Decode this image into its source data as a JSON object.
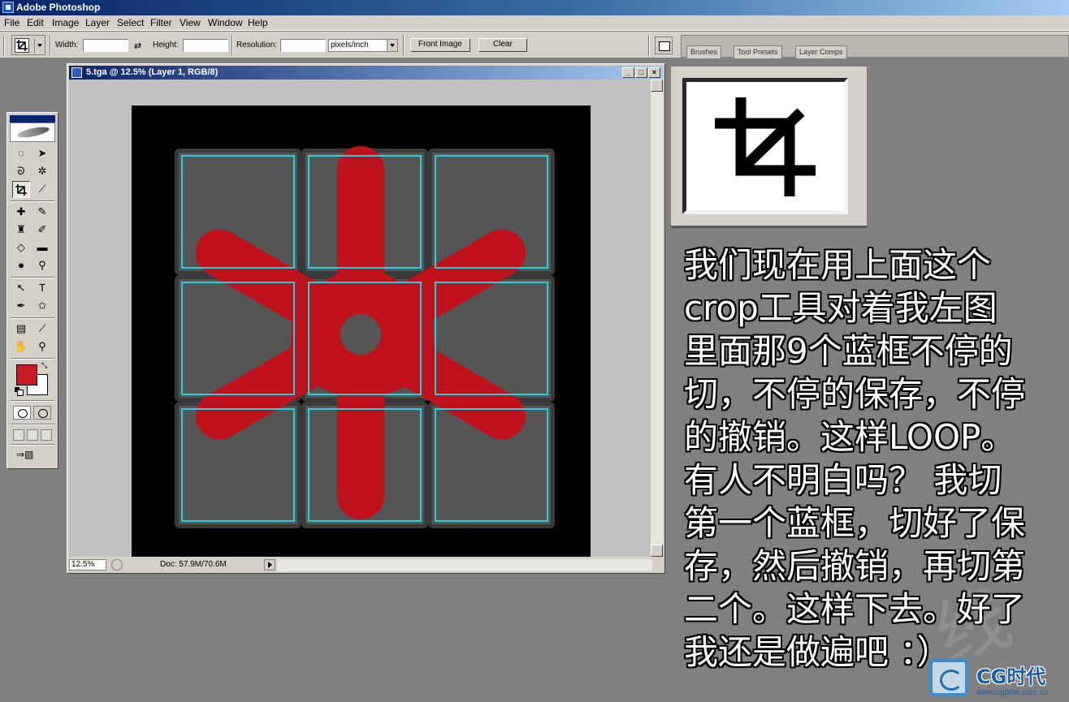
{
  "app": {
    "title": "Adobe Photoshop"
  },
  "menubar": {
    "items": [
      "File",
      "Edit",
      "Image",
      "Layer",
      "Select",
      "Filter",
      "View",
      "Window",
      "Help"
    ]
  },
  "options_bar": {
    "width_label": "Width:",
    "width_value": "",
    "height_label": "Height:",
    "height_value": "",
    "resolution_label": "Resolution:",
    "resolution_value": "",
    "resolution_unit": "pixels/inch",
    "front_image_label": "Front Image",
    "clear_label": "Clear"
  },
  "palette_well": {
    "tabs": [
      "Brushes",
      "Tool Presets",
      "Layer Comps"
    ]
  },
  "document": {
    "title": "5.tga @ 12.5% (Layer 1, RGB/8)",
    "zoom": "12.5%",
    "doc_info": "Doc: 57.9M/70.6M",
    "grid_rows": 3,
    "grid_cols": 3,
    "colors": {
      "background": "#000000",
      "cell_fill": "#555555",
      "cell_border": "#22d0e0",
      "shape": "#c0121c"
    }
  },
  "toolbox": {
    "foreground_color": "#c81c24",
    "background_color": "#ffffff",
    "active_tool": "crop-tool"
  },
  "tutorial": {
    "lines": [
      "我们现在用上面这个",
      "crop工具对着我左图",
      "里面那9个蓝框不停的",
      "切，不停的保存，不停",
      "的撤销。这样LOOP。",
      "有人不明白吗？ 我切",
      "第一个蓝框，切好了保",
      "存，然后撤销，再切第",
      "二个。这样下去。好了",
      "我还是做遍吧 ：）"
    ]
  },
  "watermark": {
    "brand": "CG时代",
    "url": "www.cgtime.com.cn"
  }
}
